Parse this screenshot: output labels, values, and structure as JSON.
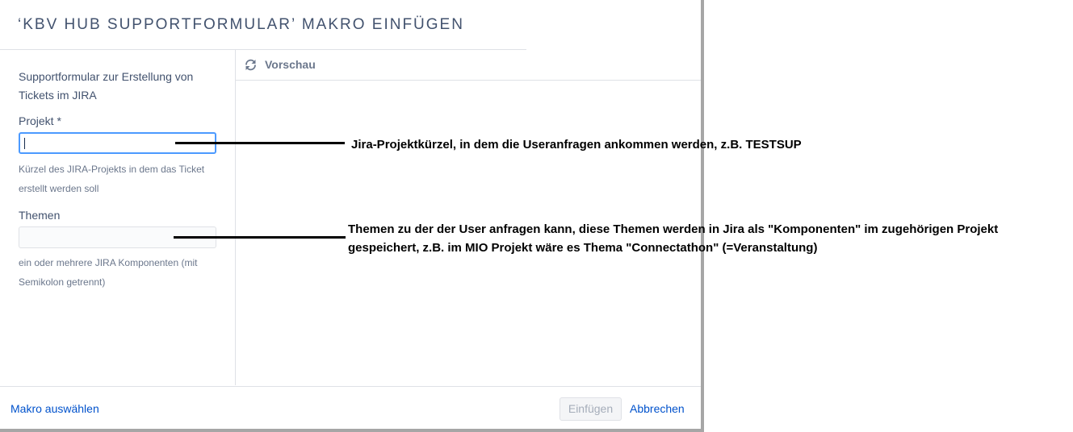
{
  "dialog": {
    "title": "‘KBV HUB SUPPORTFORMULAR’ MAKRO EINFÜGEN"
  },
  "form": {
    "description": "Supportformular zur Erstellung von Tickets im JIRA",
    "project": {
      "label": "Projekt *",
      "value": "",
      "help": "Kürzel des JIRA-Projekts in dem das Ticket erstellt werden soll"
    },
    "topics": {
      "label": "Themen",
      "value": "",
      "help": "ein oder mehrere JIRA Komponenten (mit Semikolon getrennt)"
    }
  },
  "preview": {
    "label": "Vorschau",
    "icon": "refresh-icon"
  },
  "footer": {
    "select_macro": "Makro auswählen",
    "insert": "Einfügen",
    "cancel": "Abbrechen"
  },
  "annotations": {
    "project_note": "Jira-Projektkürzel, in dem die Useranfragen ankommen werden, z.B. TESTSUP",
    "topics_note_line1": "Themen zu der der User anfragen kann, diese Themen werden in Jira als \"Komponenten\" im zugehörigen Projekt",
    "topics_note_line2": "gespeichert, z.B. im MIO Projekt wäre es Thema \"Connectathon\" (=Veranstaltung)"
  },
  "colors": {
    "link": "#0052cc",
    "focus_border": "#4c9aff",
    "title_text": "#42526e"
  }
}
